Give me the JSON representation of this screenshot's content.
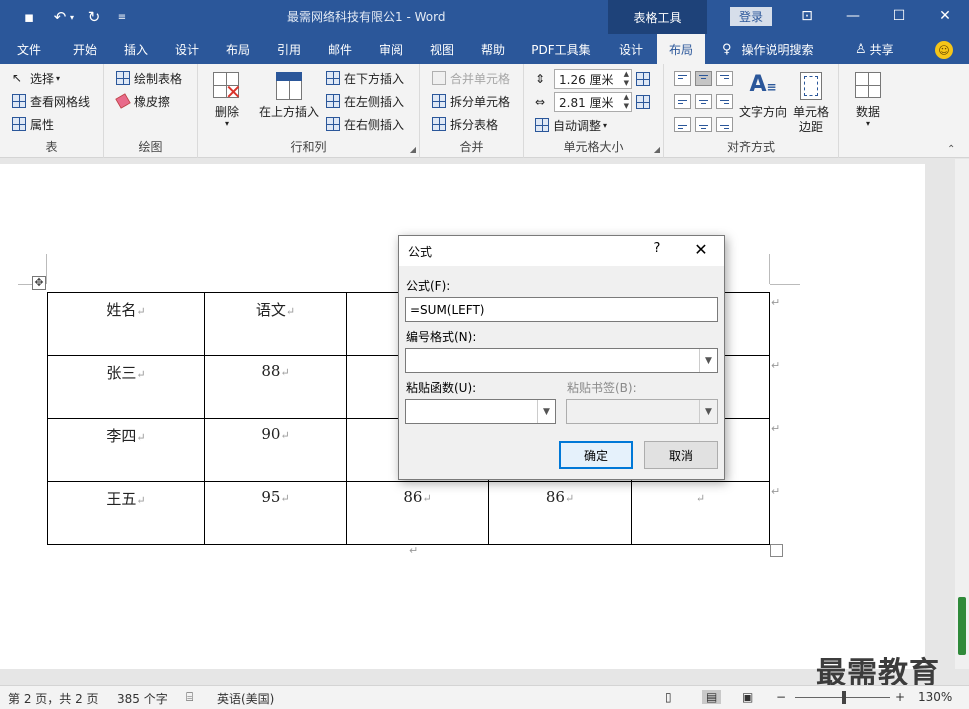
{
  "titlebar": {
    "doc_title": "最需网络科技有限公1  -  Word",
    "context_tab": "表格工具",
    "login": "登录"
  },
  "tabs": [
    "文件",
    "开始",
    "插入",
    "设计",
    "布局",
    "引用",
    "邮件",
    "审阅",
    "视图",
    "帮助",
    "PDF工具集",
    "设计",
    "布局"
  ],
  "tell_me": "操作说明搜索",
  "share": "共享",
  "ribbon": {
    "table_group": {
      "label": "表",
      "select": "选择",
      "gridlines": "查看网格线",
      "properties": "属性"
    },
    "draw_group": {
      "label": "绘图",
      "draw_table": "绘制表格",
      "eraser": "橡皮擦"
    },
    "rows_cols_group": {
      "label": "行和列",
      "delete": "删除",
      "insert_above": "在上方插入",
      "insert_below": "在下方插入",
      "insert_left": "在左侧插入",
      "insert_right": "在右侧插入"
    },
    "merge_group": {
      "label": "合并",
      "merge_cells": "合并单元格",
      "split_cells": "拆分单元格",
      "split_table": "拆分表格"
    },
    "cell_size_group": {
      "label": "单元格大小",
      "height": "1.26 厘米",
      "width": "2.81 厘米",
      "autofit": "自动调整"
    },
    "alignment_group": {
      "label": "对齐方式",
      "text_direction": "文字方向",
      "cell_margins_1": "单元格",
      "cell_margins_2": "边距"
    },
    "data_group": {
      "data": "数据"
    }
  },
  "doc_table": {
    "headers": [
      "姓名",
      "语文",
      "",
      "",
      ""
    ],
    "rows": [
      [
        "张三",
        "88",
        "",
        "",
        ""
      ],
      [
        "李四",
        "90",
        "",
        "",
        ""
      ],
      [
        "王五",
        "95",
        "86",
        "86",
        ""
      ]
    ],
    "mark": "↵"
  },
  "dialog": {
    "title": "公式",
    "help": "?",
    "close": "✕",
    "formula_label": "公式(F):",
    "formula_value": "=SUM(LEFT)",
    "number_format_label": "编号格式(N):",
    "paste_function_label": "粘贴函数(U):",
    "paste_bookmark_label": "粘贴书签(B):",
    "ok": "确定",
    "cancel": "取消"
  },
  "statusbar": {
    "page": "第 2 页，共 2 页",
    "words": "385 个字",
    "language": "英语(美国)",
    "zoom": "130%"
  },
  "watermark": "最需教育",
  "colors": {
    "word_blue": "#2b579a",
    "context_tab": "#1e4279",
    "default_button": "#0078d7"
  }
}
